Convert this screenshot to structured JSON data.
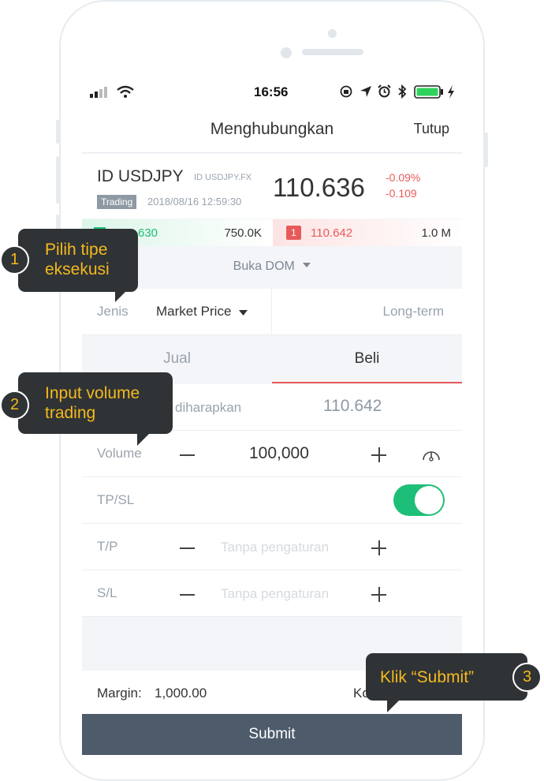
{
  "status_bar": {
    "time": "16:56"
  },
  "header": {
    "title": "Menghubungkan",
    "close_label": "Tutup"
  },
  "quote": {
    "symbol": "ID USDJPY",
    "code": "ID USDJPY.FX",
    "state_badge": "Trading",
    "timestamp": "2018/08/16 12:59:30",
    "price": "110.636",
    "change_pct": "-0.09%",
    "change_abs": "-0.109",
    "bid_price_partial": "630",
    "bid_volume": "750.0K",
    "ask_badge": "1",
    "ask_price": "110.642",
    "ask_volume": "1.0 M"
  },
  "dom": {
    "label": "Buka DOM"
  },
  "order": {
    "type_label": "Jenis",
    "type_value": "Market Price",
    "term_value": "Long-term",
    "tabs": [
      {
        "label": "Jual"
      },
      {
        "label": "Beli"
      }
    ],
    "expected_label_partial": "diharapkan",
    "expected_price": "110.642",
    "volume_label": "Volume",
    "volume_value": "100,000",
    "tpsl_label": "TP/SL",
    "tp_label": "T/P",
    "sl_label": "S/L",
    "tp_placeholder": "Tanpa pengaturan",
    "sl_placeholder": "Tanpa pengaturan",
    "tpsl_enabled": true
  },
  "footer": {
    "margin_label": "Margin:",
    "margin_value": "1,000.00",
    "right_label_partial": "Ko",
    "submit_label": "Submit"
  },
  "callouts": [
    {
      "number": "1",
      "line1": "Pilih tipe",
      "line2": "eksekusi"
    },
    {
      "number": "2",
      "line1": "Input volume",
      "line2": "trading"
    },
    {
      "number": "3",
      "text": "Klik “Submit”"
    }
  ],
  "colors": {
    "accent_green": "#1dbf78",
    "accent_red": "#e85a5a",
    "submit_bg": "#4d5b6b",
    "callout_text": "#f5b91d"
  },
  "icons": [
    "signal-icon",
    "wifi-icon",
    "rotation-lock-icon",
    "location-icon",
    "alarm-icon",
    "bluetooth-icon",
    "battery-icon",
    "charging-icon",
    "caret-down-icon",
    "speedometer-icon"
  ]
}
